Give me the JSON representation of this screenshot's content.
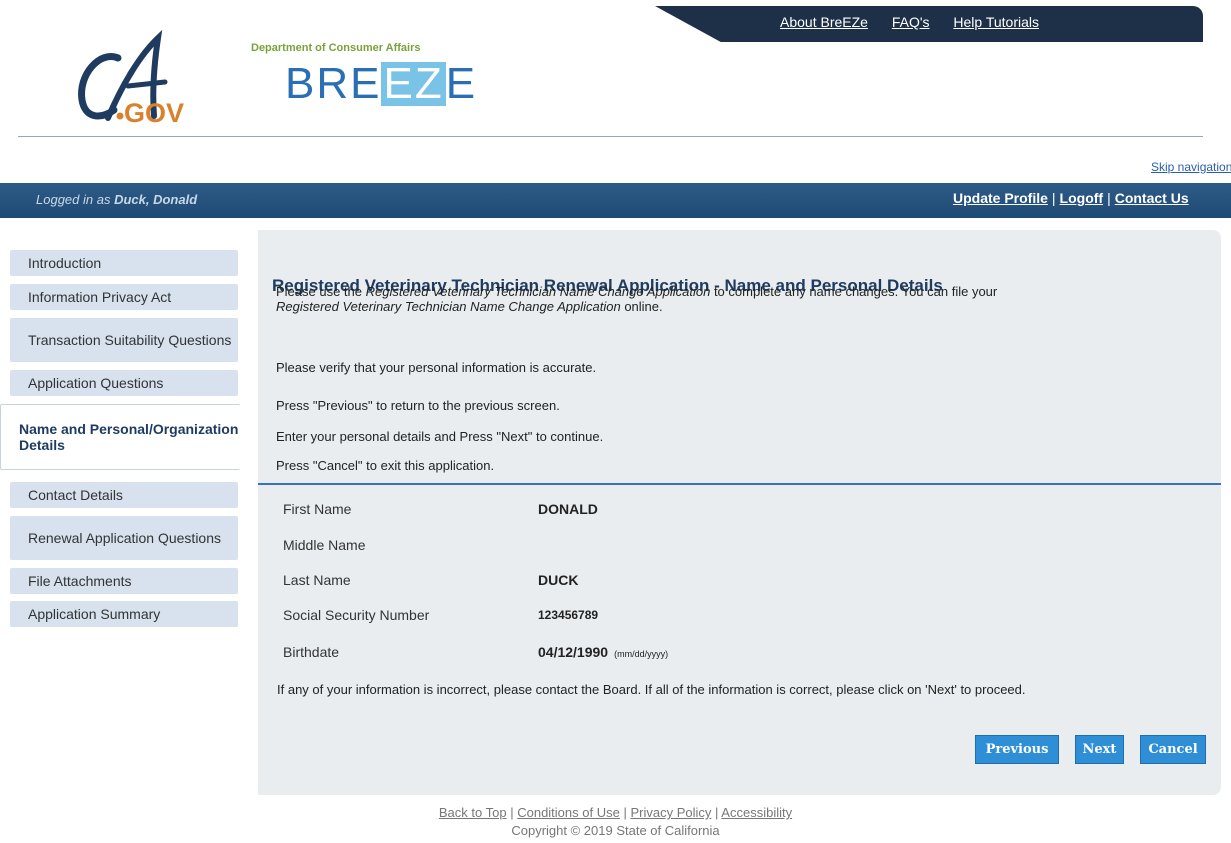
{
  "header": {
    "nav": [
      "About BreEZe",
      "FAQ's",
      "Help Tutorials"
    ],
    "ca_logo_text": "CA.GOV",
    "dept_text": "Department of Consumer Affairs",
    "brand_pre": "BRE",
    "brand_box": "EZ",
    "brand_post": "E"
  },
  "skip_nav": "Skip navigation",
  "bar": {
    "logged_prefix": "Logged in as ",
    "user": "Duck, Donald",
    "links": [
      "Update Profile",
      "Logoff",
      "Contact Us"
    ],
    "sep": "|"
  },
  "sidebar": {
    "items": [
      "Introduction",
      "Information Privacy Act",
      "Transaction Suitability Questions",
      "Application Questions",
      "Name and Personal/Organization Details",
      "Contact Details",
      "Renewal Application Questions",
      "File Attachments",
      "Application Summary"
    ]
  },
  "main": {
    "title": "Registered Veterinary Technician Renewal Application - Name and Personal Details",
    "intro_a": "Please use the ",
    "intro_b": "Registered Veterinary Technician Name Change Application",
    "intro_c": " to complete any name changes. You can file your",
    "intro_d": "Registered Veterinary Technician Name Change Application",
    "intro_e": " online.",
    "verify": "Please verify that your personal information is accurate.",
    "inst1": "Press \"Previous\" to return to the previous screen.",
    "inst2": "Enter your personal details and Press \"Next\" to continue.",
    "inst3": "Press \"Cancel\" to exit this application.",
    "fields": [
      {
        "label": "First Name",
        "value": "DONALD"
      },
      {
        "label": "Middle Name",
        "value": ""
      },
      {
        "label": "Last Name",
        "value": "DUCK"
      },
      {
        "label": "Social Security Number",
        "value": "123456789"
      },
      {
        "label": "Birthdate",
        "value": "04/12/1990",
        "format": "(mm/dd/yyyy)"
      }
    ],
    "notice": "If any of your information is incorrect, please contact the Board. If all of the information is correct, please click on 'Next' to proceed.",
    "buttons": {
      "previous": "Previous",
      "next": "Next",
      "cancel": "Cancel"
    }
  },
  "footer": {
    "links": [
      "Back to Top",
      "Conditions of Use",
      "Privacy Policy",
      "Accessibility"
    ],
    "copyright": "Copyright © 2019 State of California"
  }
}
